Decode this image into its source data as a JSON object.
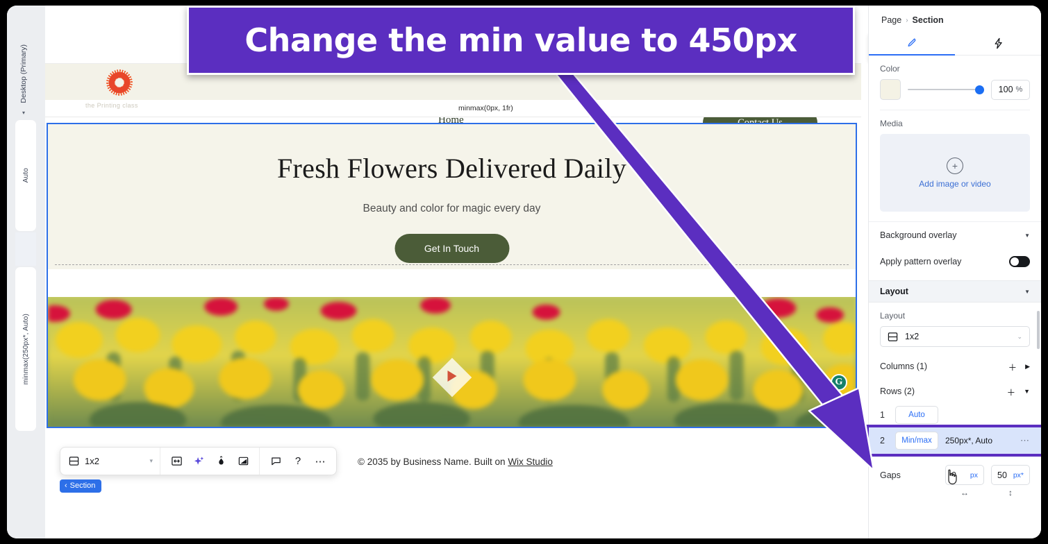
{
  "callout": {
    "text": "Change the min value to 450px",
    "bg": "#5b2ec0"
  },
  "left_rail": {
    "top_label": "Desktop (Primary)",
    "tracks": [
      {
        "label": "Auto"
      },
      {
        "label": "minmax(250px*, Auto)"
      }
    ]
  },
  "canvas": {
    "column_label": "minmax(0px, 1fr)",
    "faint_label": "the Printing class",
    "nav": {
      "home": "Home",
      "contact": "Contact Us"
    },
    "hero": {
      "title": "Fresh Flowers Delivered Daily",
      "subtitle": "Beauty and color for magic every day",
      "cta": "Get In Touch"
    },
    "footer": {
      "copyright_prefix": "© 2035 by Business Name. Built on ",
      "copyright_link": "Wix Studio"
    }
  },
  "toolbar": {
    "layout_value": "1x2",
    "icons": [
      {
        "name": "stretch-icon",
        "glyph": "↔"
      },
      {
        "name": "ai-sparkle-icon",
        "glyph": "✦"
      },
      {
        "name": "theme-icon",
        "glyph": "◉"
      },
      {
        "name": "crop-icon",
        "glyph": "◪"
      },
      {
        "name": "comment-icon",
        "glyph": "❏"
      },
      {
        "name": "help-icon",
        "glyph": "?"
      },
      {
        "name": "more-icon",
        "glyph": "⋯"
      }
    ],
    "section_chip": "Section"
  },
  "panel": {
    "breadcrumb": {
      "parent": "Page",
      "separator": "›",
      "current": "Section"
    },
    "tabs": [
      {
        "name": "design-tab",
        "glyph": "🖌",
        "active": true
      },
      {
        "name": "interactions-tab",
        "glyph": "⚡",
        "active": false
      }
    ],
    "color": {
      "label": "Color",
      "swatch_hex": "#f4f2e5",
      "opacity_value": "100",
      "opacity_unit": "%"
    },
    "media": {
      "label": "Media",
      "add_label": "Add image or video"
    },
    "background_overlay_label": "Background overlay",
    "apply_pattern_overlay_label": "Apply pattern overlay",
    "apply_pattern_overlay_on": true,
    "layout_section": {
      "header": "Layout",
      "sub_label": "Layout",
      "select_value": "1x2",
      "columns_label": "Columns (1)",
      "rows_label": "Rows (2)",
      "rows": [
        {
          "index": "1",
          "mode": "Auto",
          "value": ""
        },
        {
          "index": "2",
          "mode": "Min/max",
          "value": "250px*, Auto",
          "selected": true
        }
      ],
      "gaps_label": "Gaps",
      "gaps": [
        {
          "value": "0",
          "unit": "px"
        },
        {
          "value": "50",
          "unit": "px*"
        }
      ],
      "gap_icons": [
        "↔",
        "↕"
      ]
    }
  }
}
